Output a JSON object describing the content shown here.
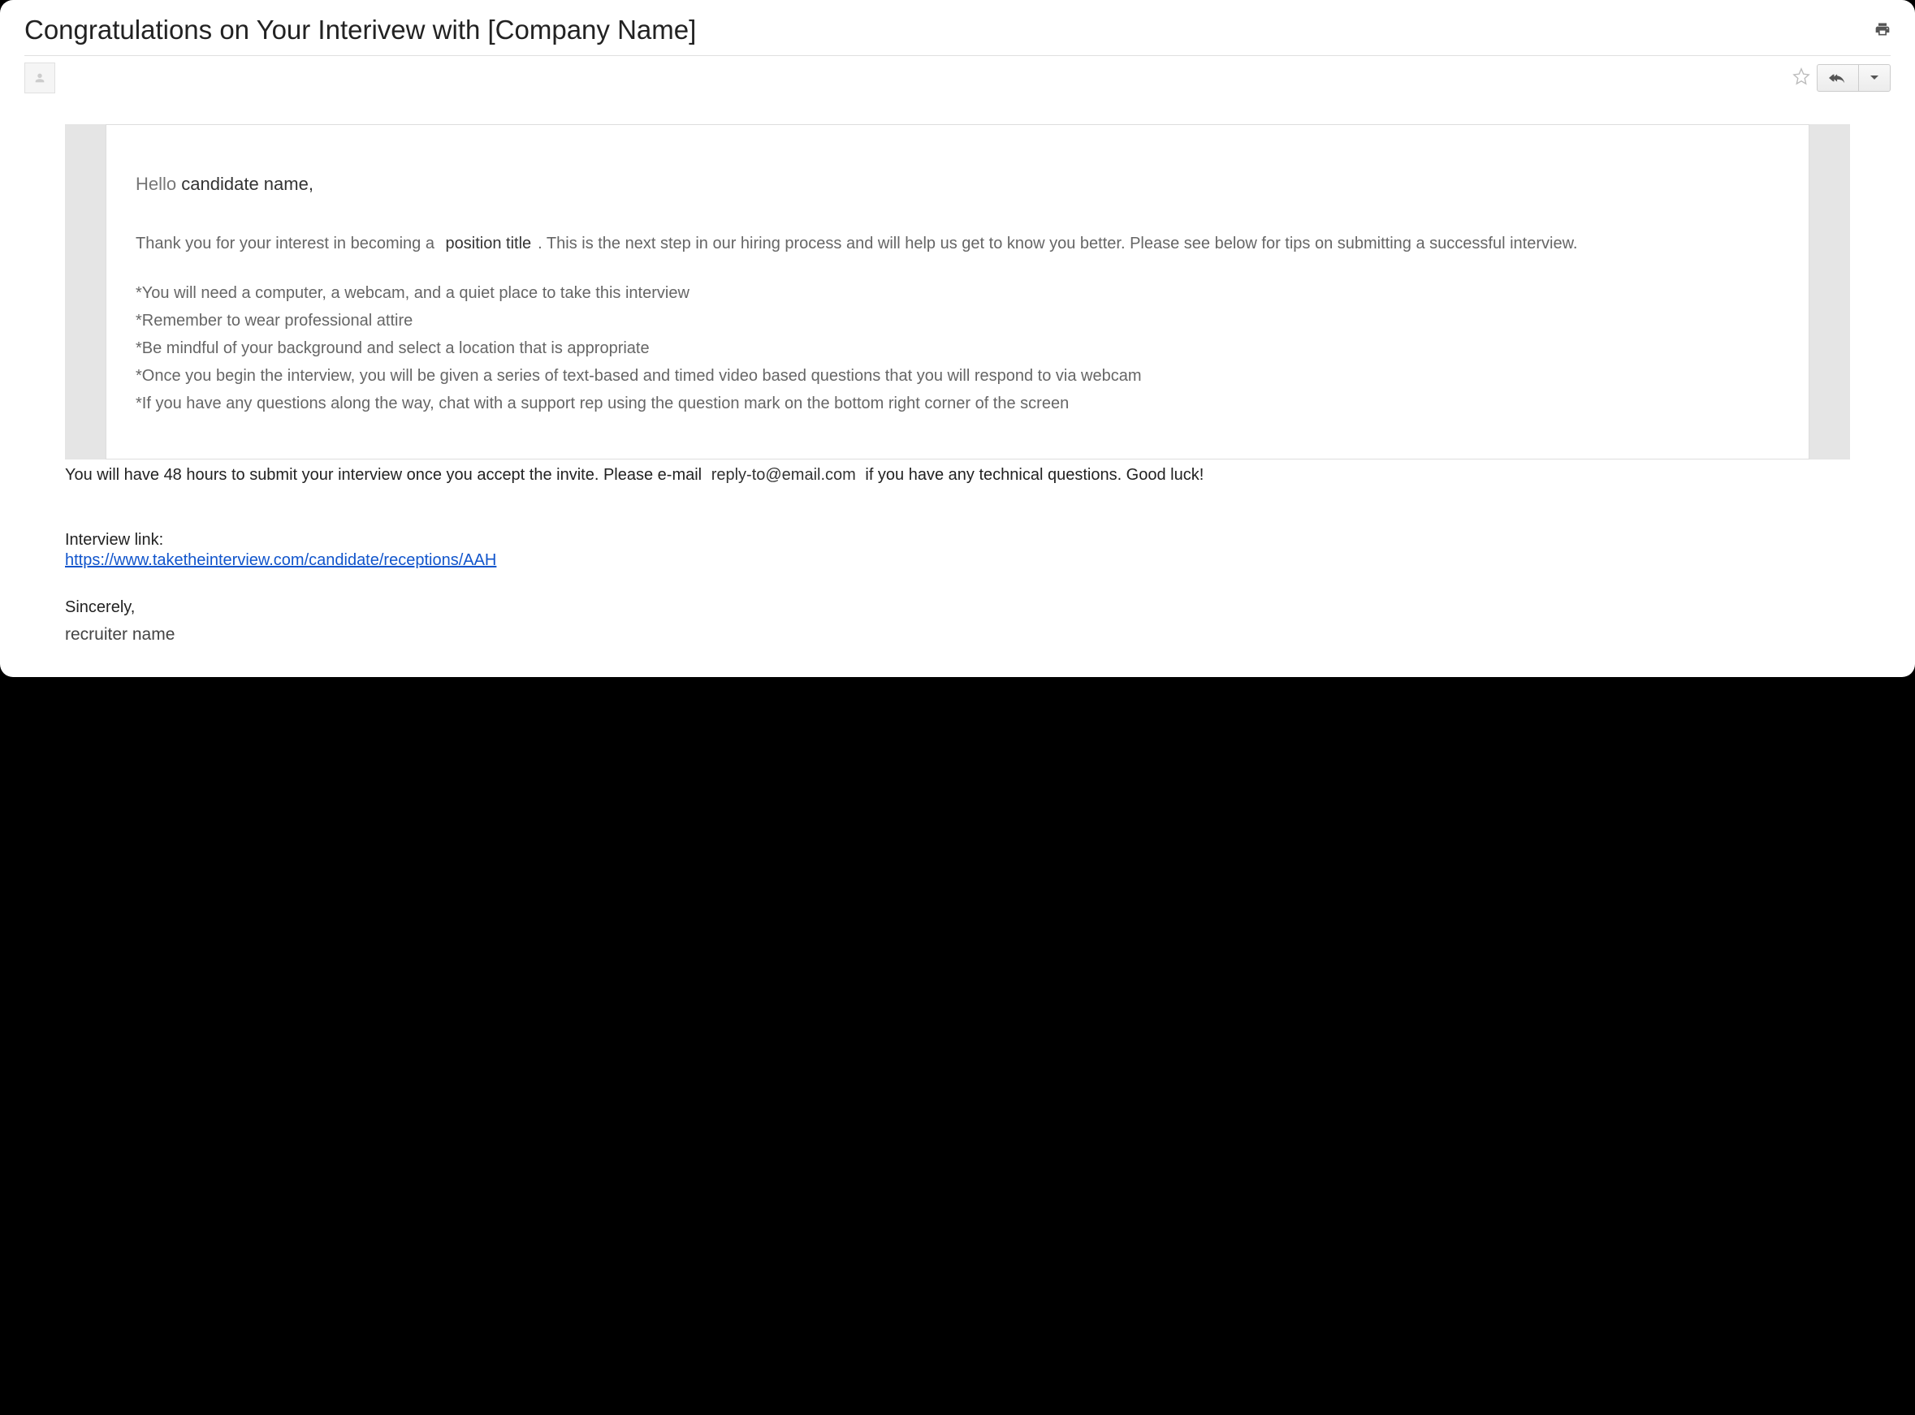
{
  "email": {
    "subject": "Congratulations on Your Interivew with [Company Name]",
    "greeting_hello": "Hello",
    "candidate_name": "candidate name,",
    "intro_before": "Thank you for your interest in becoming a ",
    "position_title": "position title",
    "intro_after": ". This is the next step in our hiring process and will help us get to know you better. Please see below for tips on submitting a successful interview.",
    "tips": [
      "*You will need a computer, a webcam, and a quiet place to take this interview",
      "*Remember to wear professional attire",
      "*Be mindful of your background and select a location that is appropriate",
      "*Once you begin the interview, you will be given a series of text-based and timed video based questions that you will respond to via webcam",
      "*If you have any questions along the way, chat with a support rep using the question mark on the bottom right corner of the screen"
    ],
    "footer_before": "You will have 48 hours to submit your interview once you accept the invite. Please e-mail ",
    "reply_email": "reply-to@email.com",
    "footer_after": " if you have any technical questions. Good luck!",
    "link_label": "Interview link:",
    "interview_url": "https://www.taketheinterview.com/candidate/receptions/AAH",
    "signoff": "Sincerely,",
    "recruiter_name": "recruiter name"
  }
}
